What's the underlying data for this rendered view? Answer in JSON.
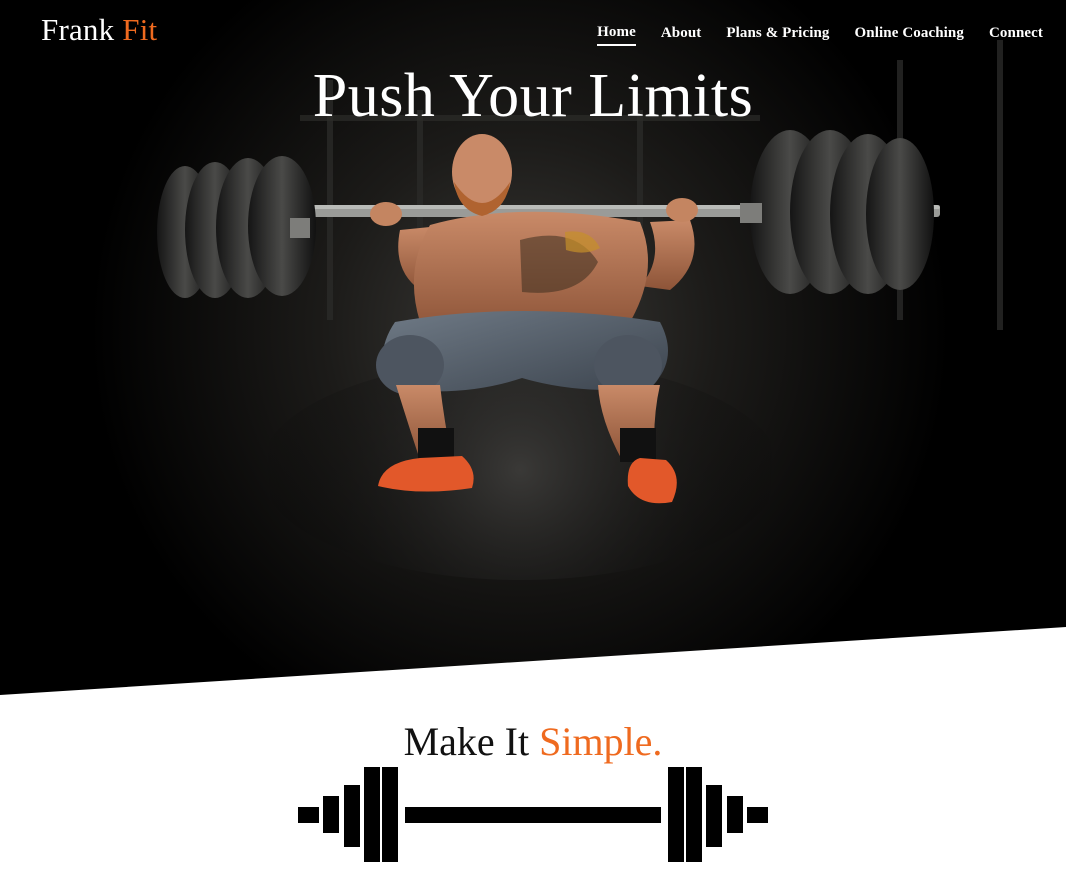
{
  "brand": {
    "name_part1": "Frank",
    "name_part2": "Fit",
    "accent_color": "#ef6a1f"
  },
  "nav": {
    "items": [
      {
        "label": "Home",
        "active": true
      },
      {
        "label": "About",
        "active": false
      },
      {
        "label": "Plans & Pricing",
        "active": false
      },
      {
        "label": "Online Coaching",
        "active": false
      },
      {
        "label": "Connect",
        "active": false
      }
    ]
  },
  "hero": {
    "title": "Push Your Limits"
  },
  "section": {
    "title_part1": "Make It",
    "title_part2": "Simple."
  },
  "icons": {
    "barbell": "barbell-icon"
  },
  "colors": {
    "background_dark": "#000000",
    "accent": "#ef6a1f",
    "text_light": "#ffffff",
    "text_dark": "#111111"
  }
}
